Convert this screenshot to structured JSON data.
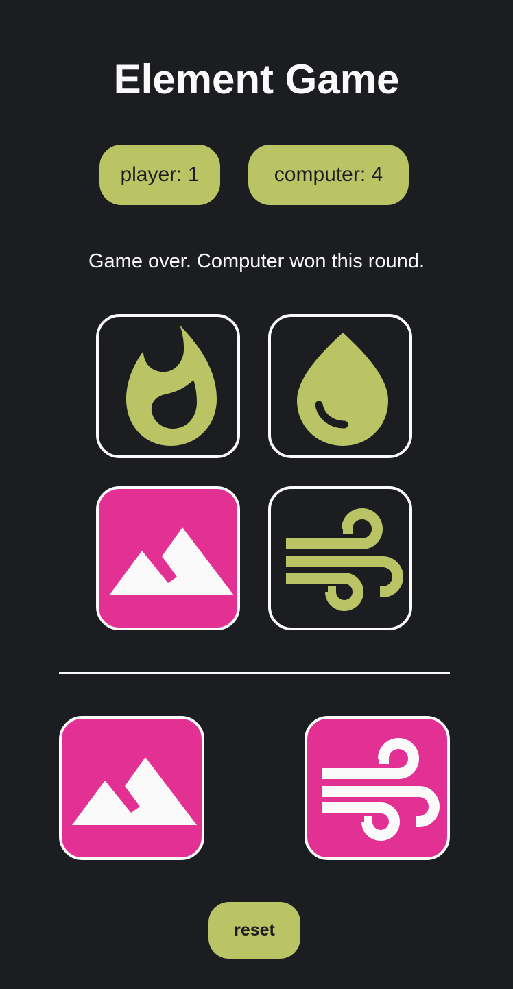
{
  "title": "Element Game",
  "scores": {
    "player": "player: 1",
    "computer": "computer: 4"
  },
  "message": "Game over. Computer won this round.",
  "choices": [
    {
      "element": "fire",
      "icon": "fire-icon",
      "selected": false
    },
    {
      "element": "water",
      "icon": "water-drop-icon",
      "selected": false
    },
    {
      "element": "earth",
      "icon": "mountain-icon",
      "selected": true
    },
    {
      "element": "wind",
      "icon": "wind-icon",
      "selected": false
    }
  ],
  "result": {
    "player_choice": "earth",
    "computer_choice": "wind"
  },
  "reset_label": "reset",
  "colors": {
    "background": "#1c1d21",
    "accent": "#bac465",
    "highlight": "#e33093",
    "white": "#fafafa"
  }
}
